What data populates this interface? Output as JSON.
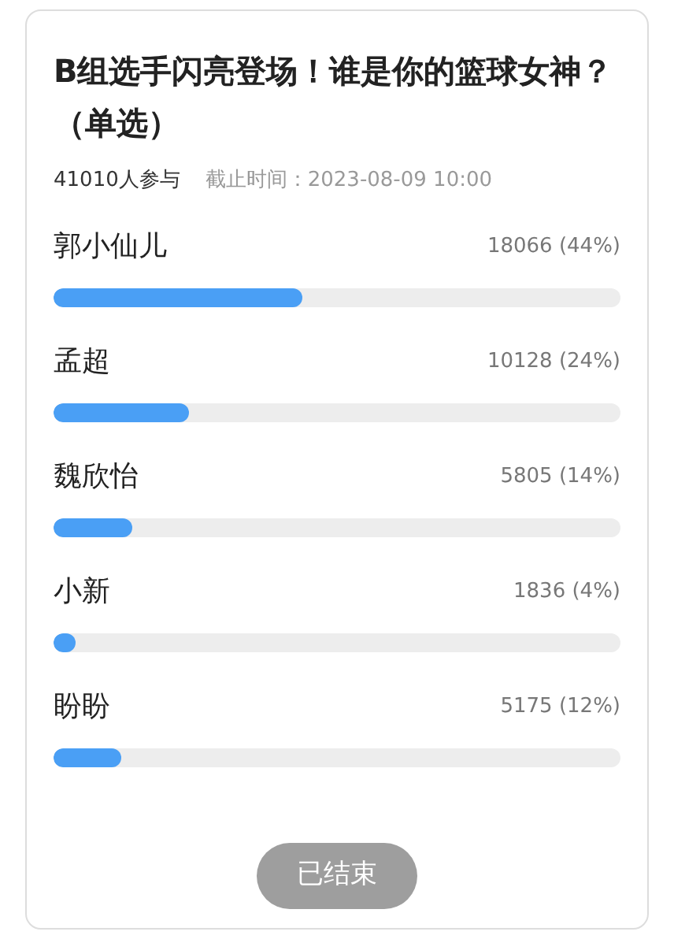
{
  "poll": {
    "title": "B组选手闪亮登场！谁是你的篮球女神？（单选）",
    "participants": "41010人参与",
    "deadline": "截止时间：2023-08-09 10:00",
    "options": [
      {
        "name": "郭小仙儿",
        "result": "18066 (44%)",
        "level": 0.44
      },
      {
        "name": "孟超",
        "result": "10128 (24%)",
        "level": 0.24
      },
      {
        "name": "魏欣怡",
        "result": "5805 (14%)",
        "level": 0.14
      },
      {
        "name": "小新",
        "result": "1836 (4%)",
        "level": 0.04
      },
      {
        "name": "盼盼",
        "result": "5175 (12%)",
        "level": 0.12
      }
    ],
    "button": {
      "label": "已结束",
      "disabled": true
    }
  }
}
